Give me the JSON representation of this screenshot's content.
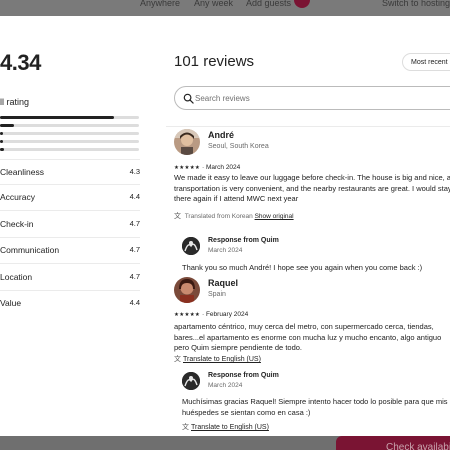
{
  "background": {
    "nav": [
      "Anywhere",
      "Any week",
      "Add guests"
    ],
    "host_link": "Switch to hosting",
    "cta": "Check availability"
  },
  "ratings": {
    "overall_score": "4.34",
    "overall_label": "ll rating",
    "distribution": [
      0.82,
      0.1,
      0.02,
      0.02,
      0.03
    ],
    "categories": [
      {
        "label": "Cleanliness",
        "value": "4.3",
        "icon": "spray-bottle-icon"
      },
      {
        "label": "Accuracy",
        "value": "4.4",
        "icon": "check-circle-icon"
      },
      {
        "label": "Check-in",
        "value": "4.7",
        "icon": "key-icon"
      },
      {
        "label": "Communication",
        "value": "4.7",
        "icon": "chat-bubble-icon"
      },
      {
        "label": "Location",
        "value": "4.7",
        "icon": "map-icon"
      },
      {
        "label": "Value",
        "value": "4.4",
        "icon": "tag-icon"
      }
    ]
  },
  "reviews_header": {
    "title": "101 reviews",
    "sort_label": "Most recent",
    "search_placeholder": "Search reviews"
  },
  "reviews": [
    {
      "name": "André",
      "location": "Seoul, South Korea",
      "rating": 5,
      "stars": "★★★★★",
      "date": "March 2024",
      "text": [
        "We made it easy to leave our luggage before check-in. The house is big and nice, and",
        "transportation is very convenient, and the nearby restaurants are great. I would stay",
        "there again if I attend MWC next year"
      ],
      "translated_note": "Translated from Korean",
      "show_original": "Show original",
      "response": {
        "from": "Response from Quim",
        "date": "March 2024",
        "text": [
          "Thank you so much André! I hope see you again when you come back :)"
        ]
      }
    },
    {
      "name": "Raquel",
      "location": "Spain",
      "rating": 5,
      "stars": "★★★★★",
      "date": "February 2024",
      "text": [
        "apartamento céntrico, muy cerca del metro, con supermercado cerca, tiendas,",
        "bares...el apartamento es enorme con mucha luz y mucho encanto, algo antiguo",
        "pero Quim siempre pendiente de todo."
      ],
      "translate_link": "Translate to English (US)",
      "response": {
        "from": "Response from Quim",
        "date": "March 2024",
        "text": [
          "Muchísimas gracias Raquel! Siempre intento hacer todo lo posible para que mis",
          "huéspedes se sientan como en casa :)"
        ],
        "translate_link": "Translate to English (US)"
      }
    }
  ]
}
